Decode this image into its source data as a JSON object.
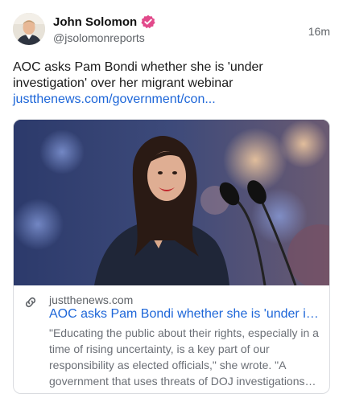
{
  "post": {
    "author": {
      "display_name": "John Solomon",
      "handle": "@jsolomonreports",
      "avatar_icon": "profile-photo",
      "verified_icon": "verified-badge-icon",
      "verified_color": "#e24a8b"
    },
    "timestamp": "16m",
    "text": "AOC asks Pam Bondi whether she is 'under investigation' over her migrant webinar",
    "link_text": "justthenews.com/government/con..."
  },
  "card": {
    "image_icon": "article-photo",
    "link_icon": "link-icon",
    "domain": "justthenews.com",
    "title": "AOC asks Pam Bondi whether she is 'under inv...",
    "description": "\"Educating the public about their rights, especially in a time of rising uncertainty, is a key part of our responsibility as elected officials,\" she wrote. \"A government that uses threats of DOJ investigations to..."
  },
  "colors": {
    "link": "#1d66d8",
    "secondary_text": "#5f6368",
    "card_border": "#dadce0"
  }
}
